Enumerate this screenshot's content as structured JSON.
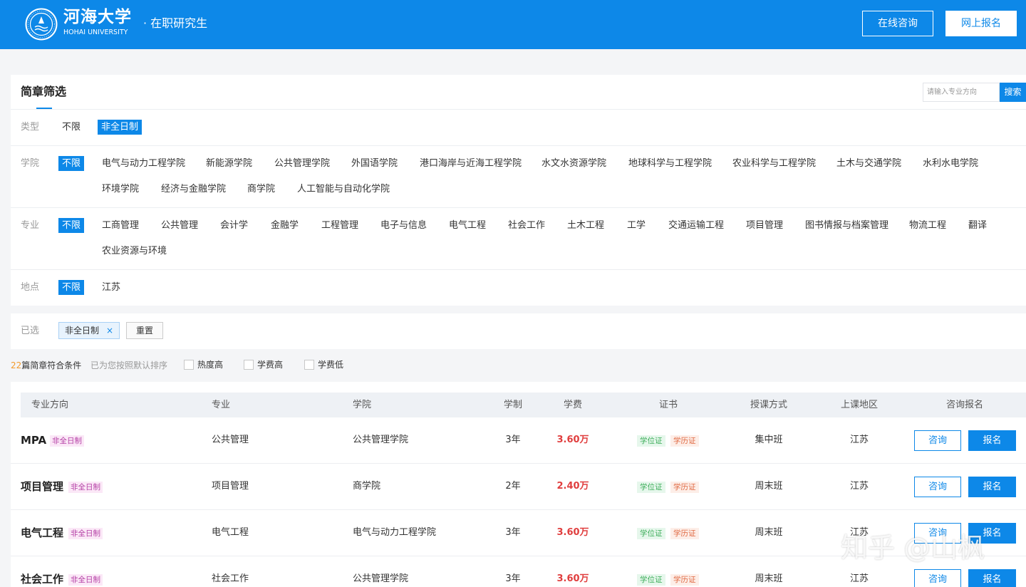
{
  "header": {
    "logo_cn": "河海大学",
    "logo_en": "HOHAI UNIVERSITY",
    "subtitle": "· 在职研究生",
    "consult_label": "在线咨询",
    "apply_label": "网上报名",
    "colors": {
      "brand": "#0d88e8"
    }
  },
  "filter": {
    "title": "简章筛选",
    "search_placeholder": "请输入专业方向",
    "search_button": "搜索",
    "type": {
      "label": "类型",
      "options": [
        "不限",
        "非全日制"
      ],
      "active": "非全日制"
    },
    "college": {
      "label": "学院",
      "options": [
        "不限",
        "电气与动力工程学院",
        "新能源学院",
        "公共管理学院",
        "外国语学院",
        "港口海岸与近海工程学院",
        "水文水资源学院",
        "地球科学与工程学院",
        "农业科学与工程学院",
        "土木与交通学院",
        "水利水电学院",
        "环境学院",
        "经济与金融学院",
        "商学院",
        "人工智能与自动化学院"
      ],
      "active": "不限"
    },
    "major": {
      "label": "专业",
      "options": [
        "不限",
        "工商管理",
        "公共管理",
        "会计学",
        "金融学",
        "工程管理",
        "电子与信息",
        "电气工程",
        "社会工作",
        "土木工程",
        "工学",
        "交通运输工程",
        "项目管理",
        "图书情报与档案管理",
        "物流工程",
        "翻译",
        "农业资源与环境"
      ],
      "active": "不限"
    },
    "location": {
      "label": "地点",
      "options": [
        "不限",
        "江苏"
      ],
      "active": "不限"
    }
  },
  "selected": {
    "label": "已选",
    "tag": "非全日制",
    "remove_icon": "×",
    "reset_label": "重置"
  },
  "sort": {
    "count": "22",
    "count_suffix": "篇简章符合条件",
    "hint": "已为您按照默认排序",
    "options": [
      "热度高",
      "学费高",
      "学费低"
    ]
  },
  "table": {
    "headers": [
      "专业方向",
      "专业",
      "学院",
      "学制",
      "学费",
      "证书",
      "授课方式",
      "上课地区",
      "咨询报名"
    ],
    "rows": [
      {
        "direction": "MPA",
        "type": "非全日制",
        "major": "公共管理",
        "college": "公共管理学院",
        "duration": "3年",
        "fee": "3.60万",
        "certs": [
          "学位证",
          "学历证"
        ],
        "mode": "集中班",
        "region": "江苏",
        "ask": "咨询",
        "register": "报名"
      },
      {
        "direction": "项目管理",
        "type": "非全日制",
        "major": "项目管理",
        "college": "商学院",
        "duration": "2年",
        "fee": "2.40万",
        "certs": [
          "学位证",
          "学历证"
        ],
        "mode": "周末班",
        "region": "江苏",
        "ask": "咨询",
        "register": "报名"
      },
      {
        "direction": "电气工程",
        "type": "非全日制",
        "major": "电气工程",
        "college": "电气与动力工程学院",
        "duration": "3年",
        "fee": "3.60万",
        "certs": [
          "学位证",
          "学历证"
        ],
        "mode": "周末班",
        "region": "江苏",
        "ask": "咨询",
        "register": "报名"
      },
      {
        "direction": "社会工作",
        "type": "非全日制",
        "major": "社会工作",
        "college": "公共管理学院",
        "duration": "3年",
        "fee": "3.60万",
        "certs": [
          "学位证",
          "学历证"
        ],
        "mode": "周末班",
        "region": "江苏",
        "ask": "咨询",
        "register": "报名"
      }
    ]
  },
  "watermark": "知乎 @山枫"
}
